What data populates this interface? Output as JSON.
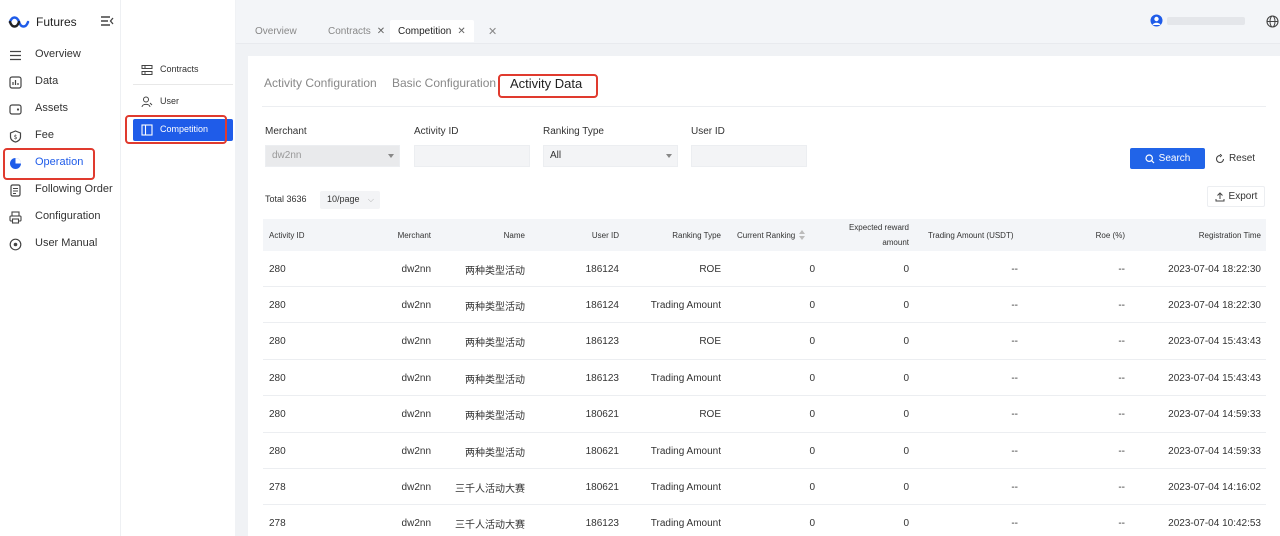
{
  "app": {
    "title": "Futures"
  },
  "nav": {
    "items": [
      {
        "label": "Overview",
        "icon": "menu-lines-icon"
      },
      {
        "label": "Data",
        "icon": "chart-box-icon"
      },
      {
        "label": "Assets",
        "icon": "wallet-icon"
      },
      {
        "label": "Fee",
        "icon": "shield-dollar-icon"
      },
      {
        "label": "Operation",
        "icon": "pie-chart-icon"
      },
      {
        "label": "Following Order",
        "icon": "document-icon"
      },
      {
        "label": "Configuration",
        "icon": "printer-icon"
      },
      {
        "label": "User Manual",
        "icon": "disc-icon"
      }
    ],
    "active_index": 4
  },
  "subnav": {
    "items": [
      {
        "label": "Contracts",
        "icon": "contract-icon"
      },
      {
        "label": "User",
        "icon": "user-icon"
      },
      {
        "label": "Competition",
        "icon": "layout-icon"
      }
    ],
    "active_index": 2
  },
  "toptabs": [
    {
      "label": "Overview",
      "closable": false
    },
    {
      "label": "Contracts",
      "closable": true
    },
    {
      "label": "Competition",
      "closable": true
    }
  ],
  "content_tabs": [
    "Activity Configuration",
    "Basic Configuration",
    "Activity Data"
  ],
  "filters": {
    "merchant": {
      "label": "Merchant",
      "value": "dw2nn"
    },
    "activity_id": {
      "label": "Activity ID",
      "value": ""
    },
    "ranking_type": {
      "label": "Ranking Type",
      "value": "All"
    },
    "user_id": {
      "label": "User ID",
      "value": ""
    }
  },
  "buttons": {
    "search": "Search",
    "reset": "Reset",
    "export": "Export"
  },
  "pagination": {
    "total": "Total 3636",
    "page_size": "10/page"
  },
  "table": {
    "headers": {
      "activity_id": "Activity ID",
      "merchant": "Merchant",
      "name": "Name",
      "user_id": "User ID",
      "ranking_type": "Ranking Type",
      "current_ranking": "Current Ranking",
      "expected_reward_1": "Expected reward",
      "expected_reward_2": "amount",
      "trading_amount": "Trading Amount (USDT)",
      "roe": "Roe (%)",
      "registration_time": "Registration Time"
    },
    "rows": [
      [
        "280",
        "dw2nn",
        "两种类型活动",
        "186124",
        "ROE",
        "0",
        "0",
        "--",
        "--",
        "2023-07-04 18:22:30"
      ],
      [
        "280",
        "dw2nn",
        "两种类型活动",
        "186124",
        "Trading Amount",
        "0",
        "0",
        "--",
        "--",
        "2023-07-04 18:22:30"
      ],
      [
        "280",
        "dw2nn",
        "两种类型活动",
        "186123",
        "ROE",
        "0",
        "0",
        "--",
        "--",
        "2023-07-04 15:43:43"
      ],
      [
        "280",
        "dw2nn",
        "两种类型活动",
        "186123",
        "Trading Amount",
        "0",
        "0",
        "--",
        "--",
        "2023-07-04 15:43:43"
      ],
      [
        "280",
        "dw2nn",
        "两种类型活动",
        "180621",
        "ROE",
        "0",
        "0",
        "--",
        "--",
        "2023-07-04 14:59:33"
      ],
      [
        "280",
        "dw2nn",
        "两种类型活动",
        "180621",
        "Trading Amount",
        "0",
        "0",
        "--",
        "--",
        "2023-07-04 14:59:33"
      ],
      [
        "278",
        "dw2nn",
        "三千人活动大赛",
        "180621",
        "Trading Amount",
        "0",
        "0",
        "--",
        "--",
        "2023-07-04 14:16:02"
      ],
      [
        "278",
        "dw2nn",
        "三千人活动大赛",
        "186123",
        "Trading Amount",
        "0",
        "0",
        "--",
        "--",
        "2023-07-04 10:42:53"
      ]
    ]
  },
  "colors": {
    "accent": "#1f5ce9",
    "highlight": "#e03a2e"
  }
}
